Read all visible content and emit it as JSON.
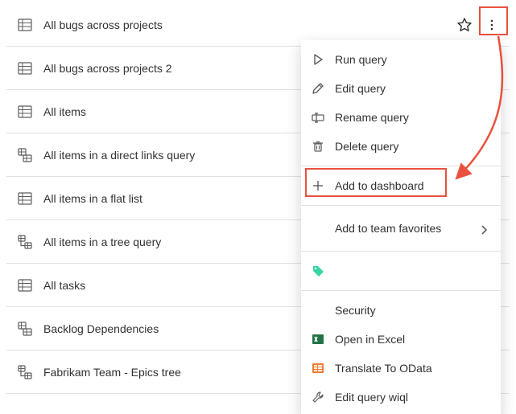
{
  "queries": [
    {
      "label": "All bugs across projects",
      "type": "flat",
      "starred": true,
      "more_open": true
    },
    {
      "label": "All bugs across projects 2",
      "type": "flat"
    },
    {
      "label": "All items",
      "type": "flat"
    },
    {
      "label": "All items in a direct links query",
      "type": "links"
    },
    {
      "label": "All items in a flat list",
      "type": "flat"
    },
    {
      "label": "All items in a tree query",
      "type": "tree"
    },
    {
      "label": "All tasks",
      "type": "flat"
    },
    {
      "label": "Backlog Dependencies",
      "type": "links"
    },
    {
      "label": "Fabrikam Team - Epics tree",
      "type": "tree"
    }
  ],
  "menu": {
    "run": "Run query",
    "edit": "Edit query",
    "rename": "Rename query",
    "delete": "Delete query",
    "add_dashboard": "Add to dashboard",
    "add_favorites": "Add to team favorites",
    "security": "Security",
    "open_excel": "Open in Excel",
    "translate_odata": "Translate To OData",
    "edit_wiql": "Edit query wiql"
  },
  "icons": {
    "star": "star-outline",
    "more": "more-vertical"
  },
  "colors": {
    "highlight": "#e9513e",
    "tag_green": "#3bd4a4"
  }
}
